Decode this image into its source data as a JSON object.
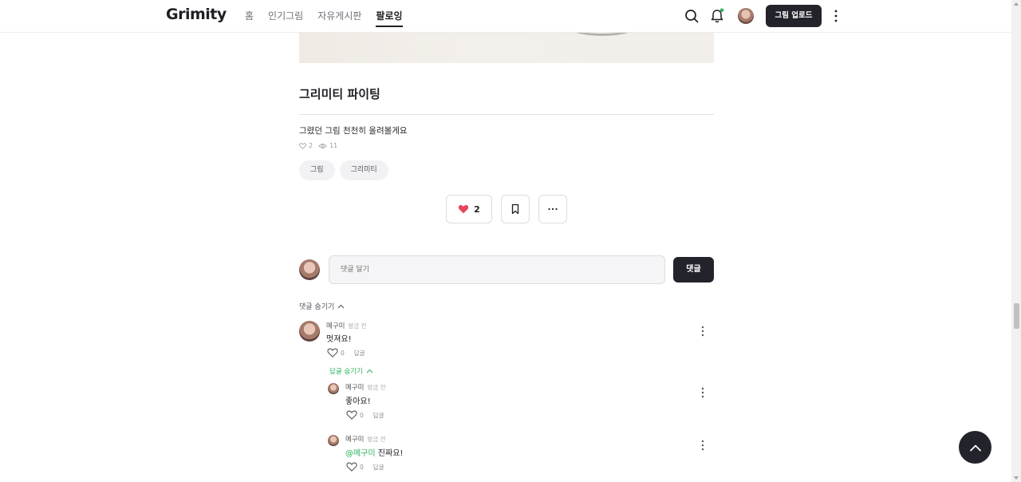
{
  "header": {
    "logo": "Grimity",
    "nav": [
      {
        "label": "홈",
        "active": false
      },
      {
        "label": "인기그림",
        "active": false
      },
      {
        "label": "자유게시판",
        "active": false
      },
      {
        "label": "팔로잉",
        "active": true
      }
    ],
    "upload_label": "그림 업로드",
    "notification_dot_color": "#2eb15d"
  },
  "post": {
    "title": "그리미티 파이팅",
    "body": "그렸던 그림 천천히 올려볼게요",
    "likes": "2",
    "views": "11",
    "tags": [
      "그림",
      "그리미티"
    ],
    "like_count": "2"
  },
  "comment_form": {
    "placeholder": "댓글 달기",
    "submit_label": "댓글"
  },
  "hide_comments_label": "댓글 숨기기",
  "comments": [
    {
      "author": "메구미",
      "time": "방금 전",
      "text": "멋져요!",
      "likes": "0",
      "reply_label": "답글"
    }
  ],
  "hide_replies_label": "답글 숨기기",
  "replies": [
    {
      "author": "메구미",
      "time": "방금 전",
      "mention": "",
      "text": "좋아요!",
      "likes": "0",
      "reply_label": "답글"
    },
    {
      "author": "메구미",
      "time": "방금 전",
      "mention": "@메구미",
      "text": "진짜요!",
      "likes": "0",
      "reply_label": "답글"
    }
  ],
  "colors": {
    "accent": "#2eb15d",
    "heart": "#e8445a",
    "dark": "#23232b"
  }
}
